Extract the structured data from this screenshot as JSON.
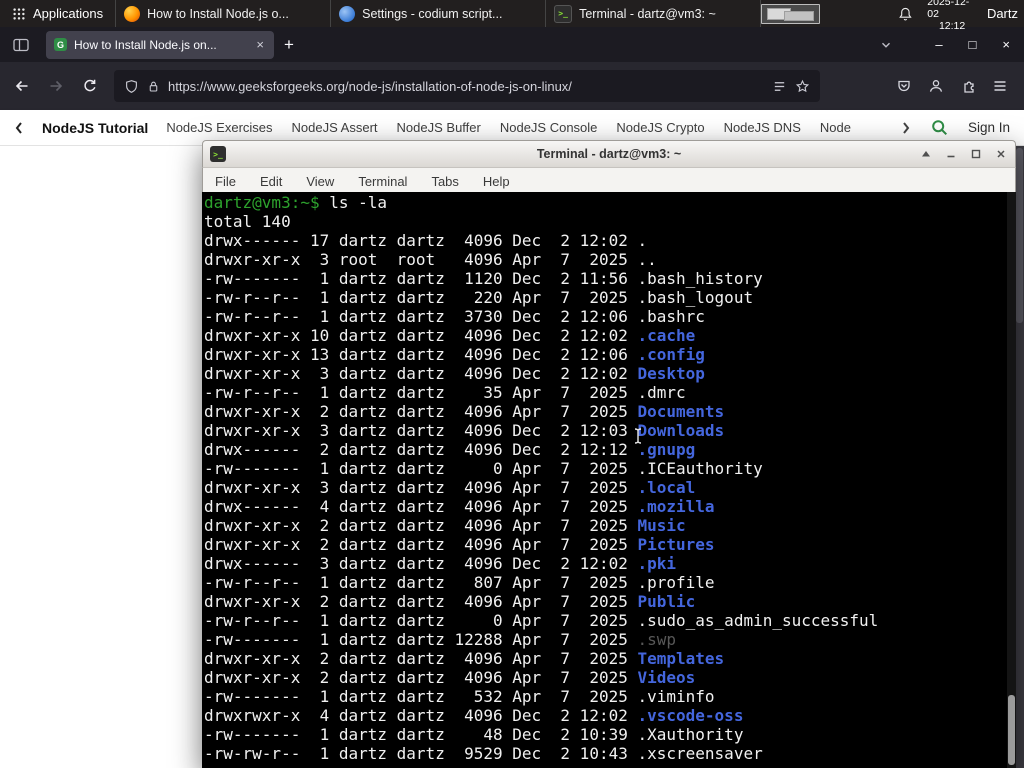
{
  "panel": {
    "apps_label": "Applications",
    "tasks": [
      {
        "icon": "firefox",
        "title": "How to Install Node.js o..."
      },
      {
        "icon": "settings",
        "title": "Settings - codium script..."
      },
      {
        "icon": "terminal",
        "title": "Terminal - dartz@vm3: ~"
      }
    ],
    "date": "2025-12-02",
    "time": "12:12",
    "user": "Dartz"
  },
  "icons": {
    "tab_close": "×",
    "new_tab": "+",
    "win_min": "–",
    "win_max": "□",
    "win_close": "×",
    "terminal_glyph": ">_"
  },
  "browser": {
    "tab_title": "How to Install Node.js on...",
    "url": "https://www.geeksforgeeks.org/node-js/installation-of-node-js-on-linux/"
  },
  "gfg": {
    "active_item": "NodeJS Tutorial",
    "items": [
      "NodeJS Exercises",
      "NodeJS Assert",
      "NodeJS Buffer",
      "NodeJS Console",
      "NodeJS Crypto",
      "NodeJS DNS",
      "Node"
    ],
    "sign_in": "Sign In"
  },
  "terminal": {
    "title": "Terminal - dartz@vm3: ~",
    "menu": [
      "File",
      "Edit",
      "View",
      "Terminal",
      "Tabs",
      "Help"
    ],
    "prompt": "dartz@vm3:~$",
    "command": "ls -la",
    "total": "total 140",
    "colors": {
      "background": "#000000",
      "foreground": "#f1f1f1",
      "prompt_green": "#2da22d",
      "dir_blue": "#4466dd",
      "dim": "#585858"
    },
    "listing": [
      {
        "pre": "drwx------ 17 dartz dartz  4096 Dec  2 12:02 ",
        "name": ".",
        "type": "plain"
      },
      {
        "pre": "drwxr-xr-x  3 root  root   4096 Apr  7  2025 ",
        "name": "..",
        "type": "plain"
      },
      {
        "pre": "-rw-------  1 dartz dartz  1120 Dec  2 11:56 ",
        "name": ".bash_history",
        "type": "plain"
      },
      {
        "pre": "-rw-r--r--  1 dartz dartz   220 Apr  7  2025 ",
        "name": ".bash_logout",
        "type": "plain"
      },
      {
        "pre": "-rw-r--r--  1 dartz dartz  3730 Dec  2 12:06 ",
        "name": ".bashrc",
        "type": "plain"
      },
      {
        "pre": "drwxr-xr-x 10 dartz dartz  4096 Dec  2 12:02 ",
        "name": ".cache",
        "type": "dir"
      },
      {
        "pre": "drwxr-xr-x 13 dartz dartz  4096 Dec  2 12:06 ",
        "name": ".config",
        "type": "dir"
      },
      {
        "pre": "drwxr-xr-x  3 dartz dartz  4096 Dec  2 12:02 ",
        "name": "Desktop",
        "type": "dir"
      },
      {
        "pre": "-rw-r--r--  1 dartz dartz    35 Apr  7  2025 ",
        "name": ".dmrc",
        "type": "plain"
      },
      {
        "pre": "drwxr-xr-x  2 dartz dartz  4096 Apr  7  2025 ",
        "name": "Documents",
        "type": "dir"
      },
      {
        "pre": "drwxr-xr-x  3 dartz dartz  4096 Dec  2 12:03 ",
        "name": "Downloads",
        "type": "dir"
      },
      {
        "pre": "drwx------  2 dartz dartz  4096 Dec  2 12:12 ",
        "name": ".gnupg",
        "type": "dir"
      },
      {
        "pre": "-rw-------  1 dartz dartz     0 Apr  7  2025 ",
        "name": ".ICEauthority",
        "type": "plain"
      },
      {
        "pre": "drwxr-xr-x  3 dartz dartz  4096 Apr  7  2025 ",
        "name": ".local",
        "type": "dir"
      },
      {
        "pre": "drwx------  4 dartz dartz  4096 Apr  7  2025 ",
        "name": ".mozilla",
        "type": "dir"
      },
      {
        "pre": "drwxr-xr-x  2 dartz dartz  4096 Apr  7  2025 ",
        "name": "Music",
        "type": "dir"
      },
      {
        "pre": "drwxr-xr-x  2 dartz dartz  4096 Apr  7  2025 ",
        "name": "Pictures",
        "type": "dir"
      },
      {
        "pre": "drwx------  3 dartz dartz  4096 Dec  2 12:02 ",
        "name": ".pki",
        "type": "dir"
      },
      {
        "pre": "-rw-r--r--  1 dartz dartz   807 Apr  7  2025 ",
        "name": ".profile",
        "type": "plain"
      },
      {
        "pre": "drwxr-xr-x  2 dartz dartz  4096 Apr  7  2025 ",
        "name": "Public",
        "type": "dir"
      },
      {
        "pre": "-rw-r--r--  1 dartz dartz     0 Apr  7  2025 ",
        "name": ".sudo_as_admin_successful",
        "type": "plain"
      },
      {
        "pre": "-rw-------  1 dartz dartz 12288 Apr  7  2025 ",
        "name": ".swp",
        "type": "dim"
      },
      {
        "pre": "drwxr-xr-x  2 dartz dartz  4096 Apr  7  2025 ",
        "name": "Templates",
        "type": "dir"
      },
      {
        "pre": "drwxr-xr-x  2 dartz dartz  4096 Apr  7  2025 ",
        "name": "Videos",
        "type": "dir"
      },
      {
        "pre": "-rw-------  1 dartz dartz   532 Apr  7  2025 ",
        "name": ".viminfo",
        "type": "plain"
      },
      {
        "pre": "drwxrwxr-x  4 dartz dartz  4096 Dec  2 12:02 ",
        "name": ".vscode-oss",
        "type": "dir"
      },
      {
        "pre": "-rw-------  1 dartz dartz    48 Dec  2 10:39 ",
        "name": ".Xauthority",
        "type": "plain"
      },
      {
        "pre": "-rw-rw-r--  1 dartz dartz  9529 Dec  2 10:43 ",
        "name": ".xscreensaver",
        "type": "plain"
      }
    ]
  }
}
